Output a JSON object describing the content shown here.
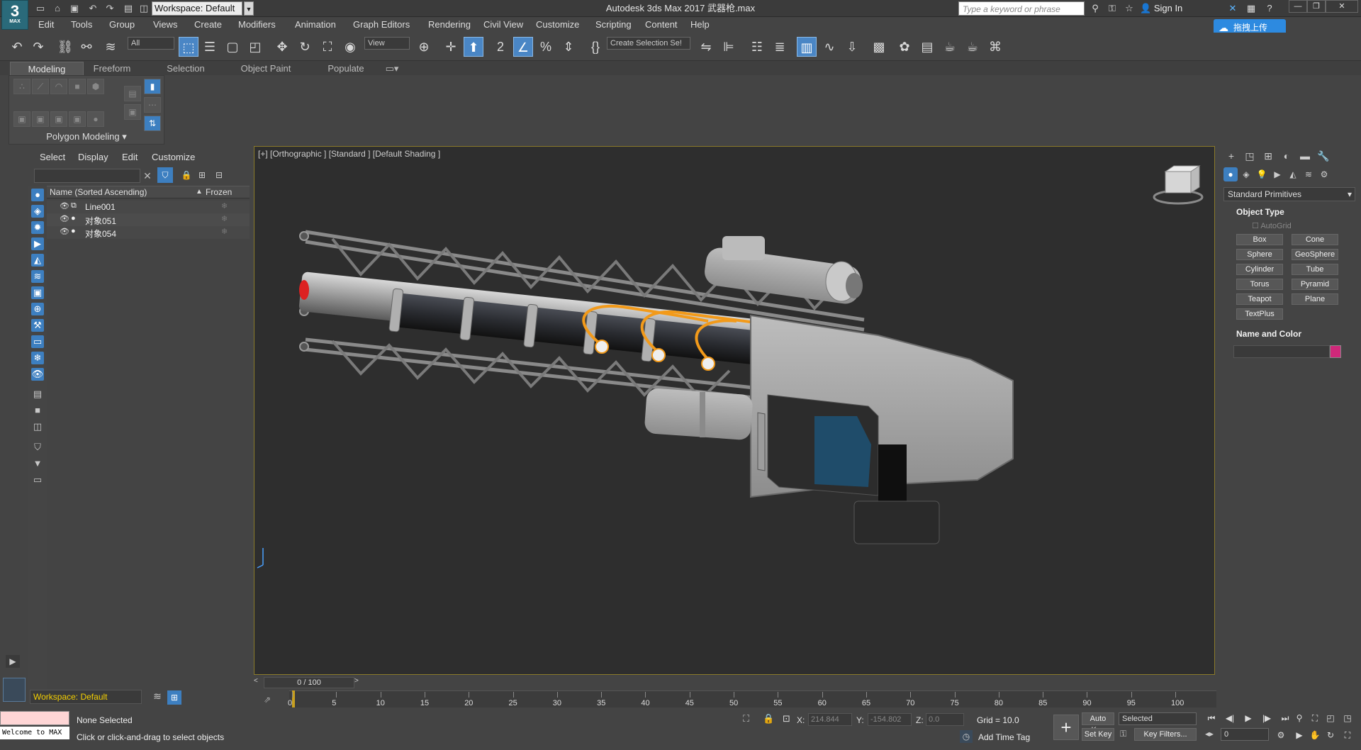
{
  "app": {
    "window_title": "Autodesk 3ds Max 2017    武器枪.max",
    "logo_text": "3",
    "logo_sub": "MAX",
    "workspace": "Workspace: Default",
    "search_placeholder": "Type a keyword or phrase",
    "sign_in": "Sign In",
    "upload_button": "拖拽上传"
  },
  "menu": [
    "Edit",
    "Tools",
    "Group",
    "Views",
    "Create",
    "Modifiers",
    "Animation",
    "Graph Editors",
    "Rendering",
    "Civil View",
    "Customize",
    "Scripting",
    "Content",
    "Help"
  ],
  "toolbar": {
    "selection_filter": "All",
    "ref_coord": "View",
    "named_sel": "Create Selection Se!"
  },
  "ribbon": {
    "tabs": [
      "Modeling",
      "Freeform",
      "Selection",
      "Object Paint",
      "Populate"
    ],
    "active_tab": "Modeling",
    "panel_label": "Polygon Modeling"
  },
  "scene_explorer": {
    "menus": [
      "Select",
      "Display",
      "Edit",
      "Customize"
    ],
    "col_name": "Name (Sorted Ascending)",
    "col_frozen": "Frozen",
    "rows": [
      {
        "name": "Line001"
      },
      {
        "name": "对象051"
      },
      {
        "name": "对象054"
      }
    ],
    "workspace_bottom": "Workspace: Default"
  },
  "viewport": {
    "label": "[+] [Orthographic ] [Standard ] [Default Shading ]"
  },
  "command_panel": {
    "category": "Standard Primitives",
    "object_type_title": "Object Type",
    "autogrid": "AutoGrid",
    "buttons": [
      "Box",
      "Cone",
      "Sphere",
      "GeoSphere",
      "Cylinder",
      "Tube",
      "Torus",
      "Pyramid",
      "Teapot",
      "Plane",
      "TextPlus"
    ],
    "name_color_title": "Name and Color",
    "object_color": "#d0287a"
  },
  "timeline": {
    "slider": "0 / 100",
    "ticks": [
      "0",
      "5",
      "10",
      "15",
      "20",
      "25",
      "30",
      "35",
      "40",
      "45",
      "50",
      "55",
      "60",
      "65",
      "70",
      "75",
      "80",
      "85",
      "90",
      "95",
      "100"
    ]
  },
  "status": {
    "listener_text": "Welcome to MAX",
    "selection": "None Selected",
    "hint": "Click or click-and-drag to select objects",
    "x_label": "X:",
    "x_value": "214.844",
    "y_label": "Y:",
    "y_value": "-154.802",
    "z_label": "Z:",
    "z_value": "0.0",
    "grid": "Grid = 10.0",
    "add_time_tag": "Add Time Tag",
    "auto_key": "Auto Key",
    "set_key": "Set Key",
    "key_mode": "Selected",
    "key_filters": "Key Filters...",
    "frame": "0"
  }
}
